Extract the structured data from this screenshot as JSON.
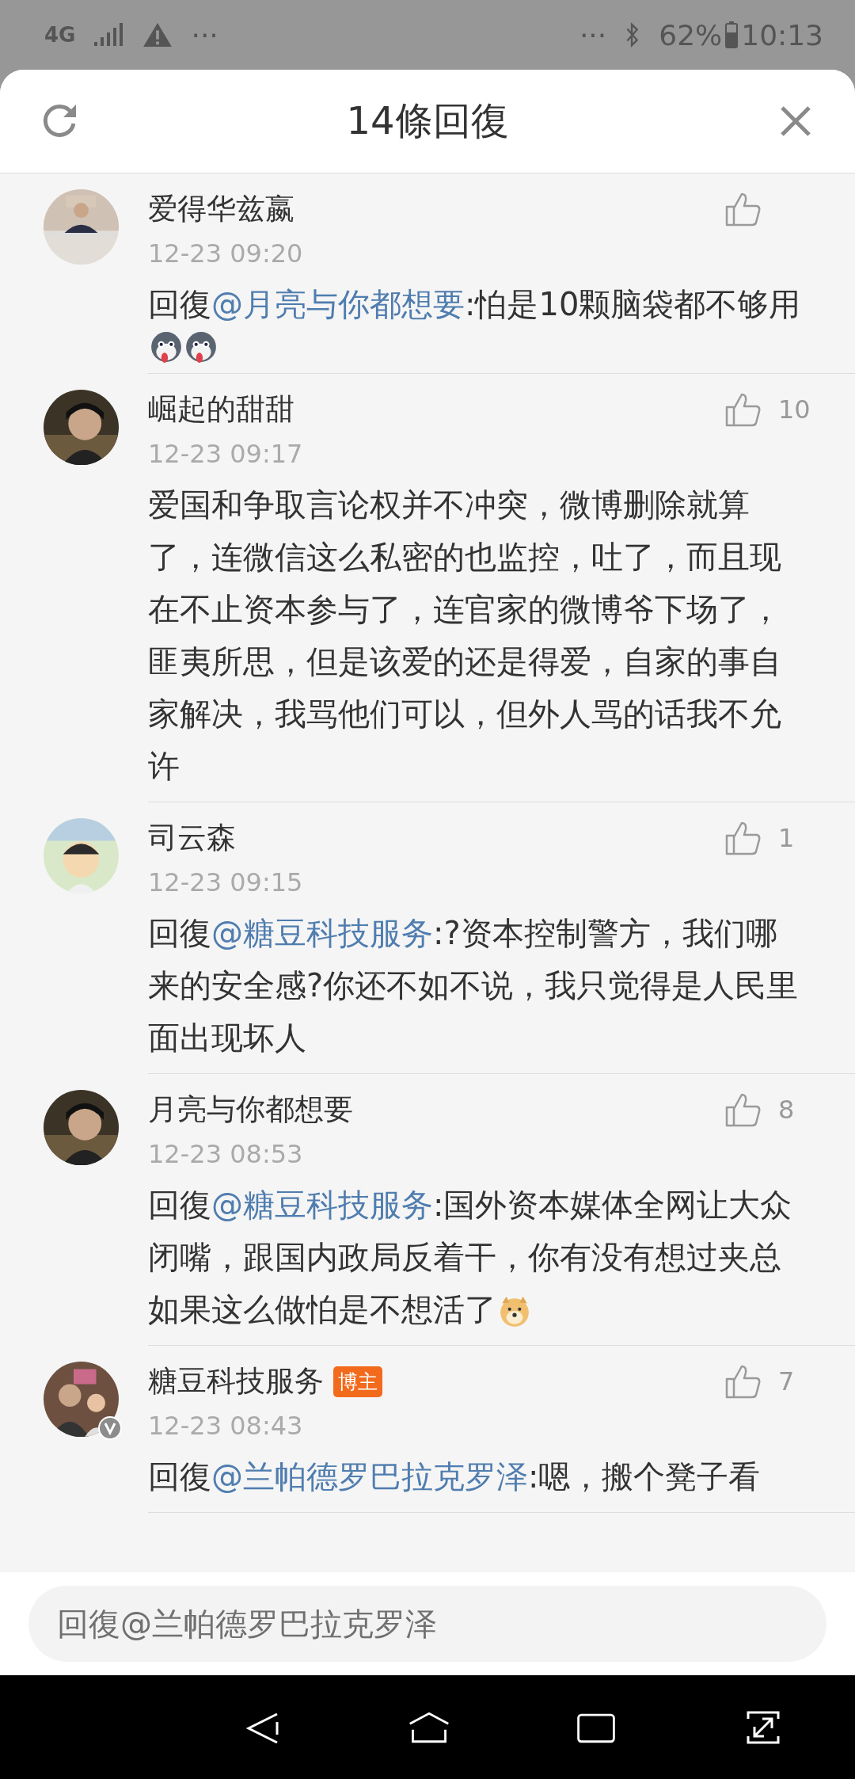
{
  "status_bar": {
    "network": "4G",
    "left_more": "···",
    "right_more": "···",
    "battery": "62%",
    "time": "10:13"
  },
  "header": {
    "title": "14條回復"
  },
  "comments": [
    {
      "name": "爱得华兹嬴",
      "time": "12-23 09:20",
      "prefix": "回復",
      "mention": "@月亮与你都想要",
      "text": ":怕是10颗脑袋都不够用",
      "emoji": [
        {
          "kind": "sticker"
        },
        {
          "kind": "sticker"
        }
      ],
      "verified": false
    },
    {
      "name": "崛起的甜甜",
      "likes": "10",
      "time": "12-23 09:17",
      "text": "爱国和争取言论权并不冲突，微博删除就算了，连微信这么私密的也监控，吐了，而且现在不止资本参与了，连官家的微博爷下场了，匪夷所思，但是该爱的还是得爱，自家的事自家解决，我骂他们可以，但外人骂的话我不允许",
      "verified": false
    },
    {
      "name": "司云森",
      "likes": "1",
      "time": "12-23 09:15",
      "prefix": "回復",
      "mention": "@糖豆科技服务",
      "text": ":?资本控制警方，我们哪来的安全感?你还不如不说，我只觉得是人民里面出现坏人",
      "verified": false
    },
    {
      "name": "月亮与你都想要",
      "likes": "8",
      "time": "12-23 08:53",
      "prefix": "回復",
      "mention": "@糖豆科技服务",
      "text": ":国外资本媒体全网让大众闭嘴，跟国内政局反着干，你有没有想过夹总如果这么做怕是不想活了",
      "emoji": [
        {
          "kind": "sticker"
        }
      ],
      "verified": false
    },
    {
      "name": "糖豆科技服务",
      "badge": "博主",
      "likes": "7",
      "time": "12-23 08:43",
      "prefix": "回復",
      "mention": "@兰帕德罗巴拉克罗泽",
      "text": ":嗯，搬个凳子看",
      "verified": true
    }
  ],
  "reply_field": {
    "placeholder": "回復@兰帕德罗巴拉克罗泽"
  }
}
